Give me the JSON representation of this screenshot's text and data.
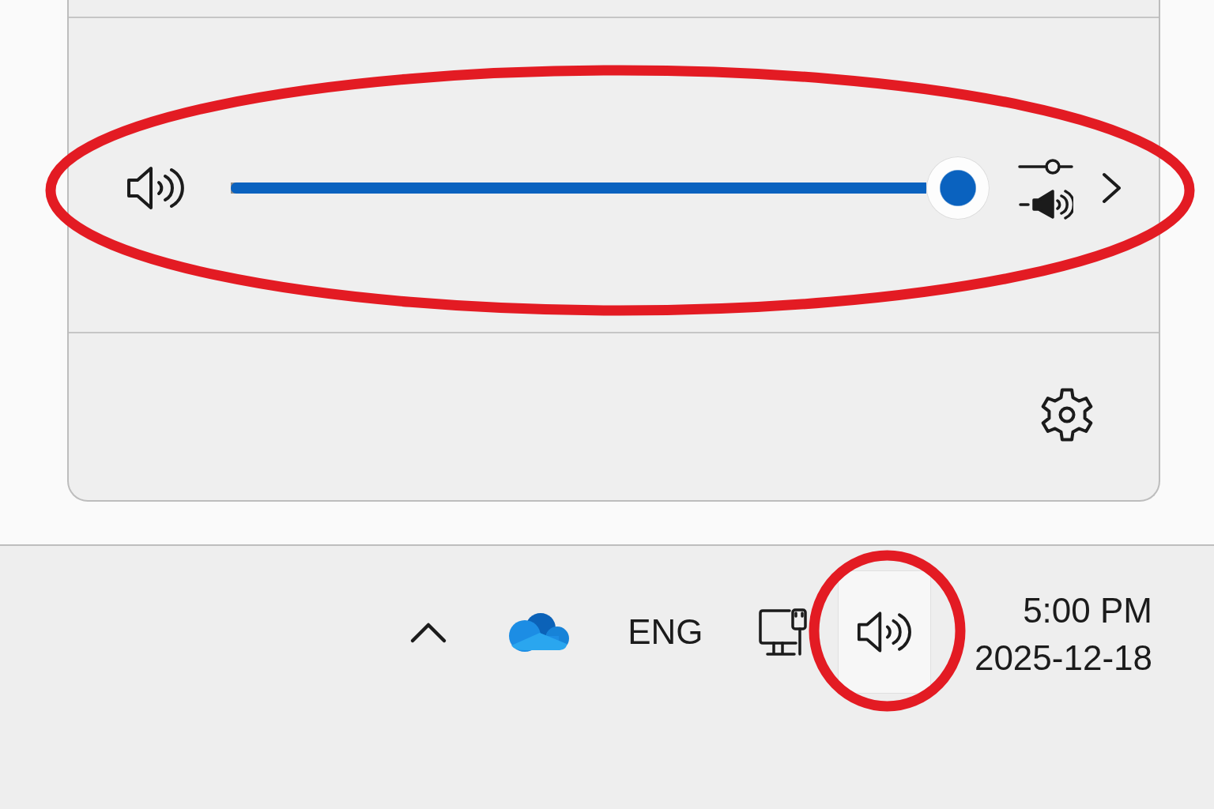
{
  "volume_flyout": {
    "output": {
      "level": 1,
      "circled": true
    }
  },
  "taskbar": {
    "tray": [
      {
        "kind": "overflow",
        "active": false,
        "circled": false
      },
      {
        "kind": "cloud",
        "active": false,
        "circled": false
      },
      {
        "kind": "language",
        "label": "ENG",
        "active": false,
        "circled": false
      },
      {
        "kind": "network",
        "active": false,
        "circled": false
      },
      {
        "kind": "volume",
        "active": true,
        "circled": true
      }
    ],
    "clock": {
      "time": "5:00 PM",
      "date": "2025-12-18"
    }
  }
}
